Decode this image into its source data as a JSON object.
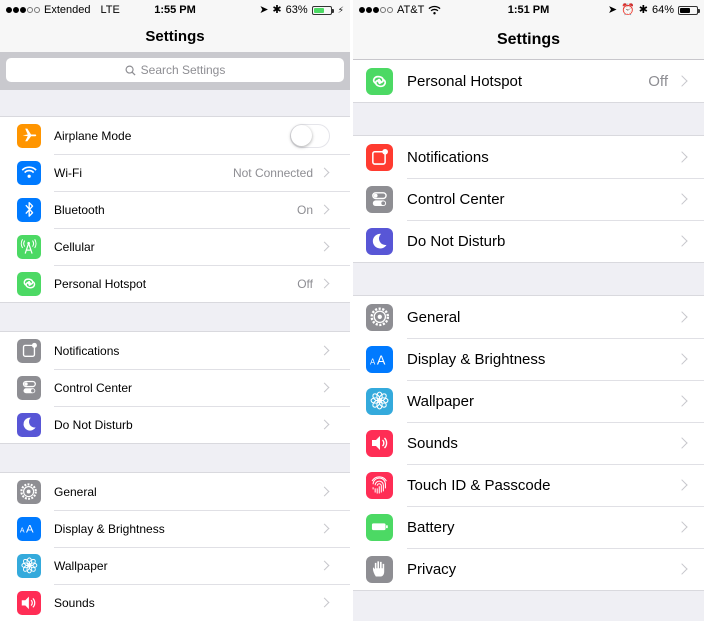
{
  "left_screen": {
    "status_bar": {
      "carrier": "Extended",
      "network": "LTE",
      "signal_bars_filled": 3,
      "signal_bars_total": 5,
      "time": "1:55 PM",
      "battery_percent": "63%",
      "battery_level": 0.63,
      "battery_color": "#4cd964",
      "charging": true
    },
    "nav_title": "Settings",
    "search": {
      "placeholder": "Search Settings"
    },
    "groups": [
      {
        "items": [
          {
            "label": "Airplane Mode",
            "icon": "airplane-icon",
            "color": "#ff9500",
            "control": "toggle",
            "toggle_on": false
          },
          {
            "label": "Wi-Fi",
            "icon": "wifi-icon",
            "color": "#007aff",
            "value": "Not Connected"
          },
          {
            "label": "Bluetooth",
            "icon": "bluetooth-icon",
            "color": "#007aff",
            "value": "On"
          },
          {
            "label": "Cellular",
            "icon": "cellular-icon",
            "color": "#4cd964",
            "value": ""
          },
          {
            "label": "Personal Hotspot",
            "icon": "hotspot-icon",
            "color": "#4cd964",
            "value": "Off"
          }
        ]
      },
      {
        "items": [
          {
            "label": "Notifications",
            "icon": "notifications-icon",
            "color": "#8e8e93"
          },
          {
            "label": "Control Center",
            "icon": "control-center-icon",
            "color": "#8e8e93"
          },
          {
            "label": "Do Not Disturb",
            "icon": "moon-icon",
            "color": "#5856d6"
          }
        ]
      },
      {
        "items": [
          {
            "label": "General",
            "icon": "gear-icon",
            "color": "#8e8e93"
          },
          {
            "label": "Display & Brightness",
            "icon": "display-icon",
            "color": "#007aff"
          },
          {
            "label": "Wallpaper",
            "icon": "wallpaper-icon",
            "color": "#34aadc"
          },
          {
            "label": "Sounds",
            "icon": "sounds-icon",
            "color": "#ff2d55"
          }
        ]
      }
    ]
  },
  "right_screen": {
    "status_bar": {
      "carrier": "AT&T",
      "signal_bars_filled": 3,
      "signal_bars_total": 5,
      "time": "1:51 PM",
      "battery_percent": "64%",
      "battery_level": 0.64,
      "battery_color": "#000000",
      "alarm": true
    },
    "nav_title": "Settings",
    "groups": [
      {
        "items": [
          {
            "label": "Personal Hotspot",
            "icon": "hotspot-icon",
            "color": "#4cd964",
            "value": "Off"
          }
        ]
      },
      {
        "items": [
          {
            "label": "Notifications",
            "icon": "notifications-icon",
            "color": "#ff3b30"
          },
          {
            "label": "Control Center",
            "icon": "control-center-icon",
            "color": "#8e8e93"
          },
          {
            "label": "Do Not Disturb",
            "icon": "moon-icon",
            "color": "#5856d6"
          }
        ]
      },
      {
        "items": [
          {
            "label": "General",
            "icon": "gear-icon",
            "color": "#8e8e93"
          },
          {
            "label": "Display & Brightness",
            "icon": "display-icon",
            "color": "#007aff"
          },
          {
            "label": "Wallpaper",
            "icon": "wallpaper-icon",
            "color": "#34aadc"
          },
          {
            "label": "Sounds",
            "icon": "sounds-icon",
            "color": "#ff2d55"
          },
          {
            "label": "Touch ID & Passcode",
            "icon": "fingerprint-icon",
            "color": "#ff2d55"
          },
          {
            "label": "Battery",
            "icon": "battery-icon",
            "color": "#4cd964"
          },
          {
            "label": "Privacy",
            "icon": "hand-icon",
            "color": "#8e8e93"
          }
        ]
      }
    ]
  }
}
